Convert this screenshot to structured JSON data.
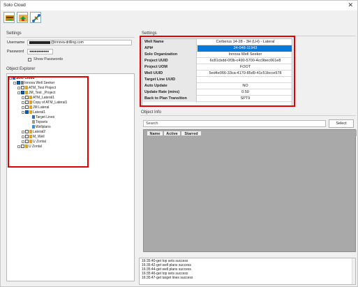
{
  "window": {
    "title": "Solo Cloud",
    "close_glyph": "✕"
  },
  "toolbar": {
    "buttons": [
      "import-icon",
      "sync-icon",
      "connect-icon"
    ]
  },
  "settings": {
    "group_label": "Settings",
    "username_label": "Username",
    "username_suffix": "@innova-drilling.com",
    "password_label": "Password",
    "password_value": "●●●●●●●●●●●",
    "show_passwords_label": "Show Passwords"
  },
  "explorer": {
    "group_label": "Object Explorer",
    "items": [
      {
        "label": "Solo Cloud",
        "bold": true
      },
      {
        "label": "Innova Well Seeker"
      },
      {
        "label": "ATM_Test Project"
      },
      {
        "label": "JM_Test _Project"
      },
      {
        "label": "ATM_Lateral1"
      },
      {
        "label": "Copy of ATM_Lateral1"
      },
      {
        "label": "JM Lateral"
      },
      {
        "label": "Lateral1"
      },
      {
        "label": "Target Lines"
      },
      {
        "label": "Topsets"
      },
      {
        "label": "Wellplans"
      },
      {
        "label": "Lateral2"
      },
      {
        "label": "M_Well"
      },
      {
        "label": "U Zontal"
      },
      {
        "label": "U Zontal"
      }
    ]
  },
  "properties": {
    "group_label": "Settings",
    "rows": [
      {
        "key": "Well Name",
        "value": "Cerberus 14-28 - 3H (LH) - Lateral"
      },
      {
        "key": "API#",
        "value": "24-048-11943"
      },
      {
        "key": "Solo Organization",
        "value": "Innova Well Seeker"
      },
      {
        "key": "Project UUID",
        "value": "6c81cbdd-0f3b-c490-5700-4cc9bec061e8"
      },
      {
        "key": "Project UOM",
        "value": "FOOT"
      },
      {
        "key": "Well UUID",
        "value": "5ed4e066-33ca-4170-85d9-41c51bcce978"
      },
      {
        "key": "Target Line UUID",
        "value": ""
      },
      {
        "key": "Auto Update",
        "value": "NO"
      },
      {
        "key": "Update Rate (mins)",
        "value": "0.50"
      },
      {
        "key": "Back to Plan Transition",
        "value": "SPT9"
      }
    ]
  },
  "object_info": {
    "group_label": "Object Info",
    "search_placeholder": "Search",
    "select_label": "Select",
    "columns": [
      "Name",
      "Active",
      "Starred"
    ]
  },
  "log": {
    "lines": [
      "16:35:40-get top sets success",
      "16:35:42-get well plans success",
      "16:35:44-get well plans success",
      "16:35:46-get top sets success",
      "16:35:47-get target lines success"
    ]
  },
  "colors": {
    "selection": "#0a78d7",
    "highlight_box": "#e00000"
  }
}
